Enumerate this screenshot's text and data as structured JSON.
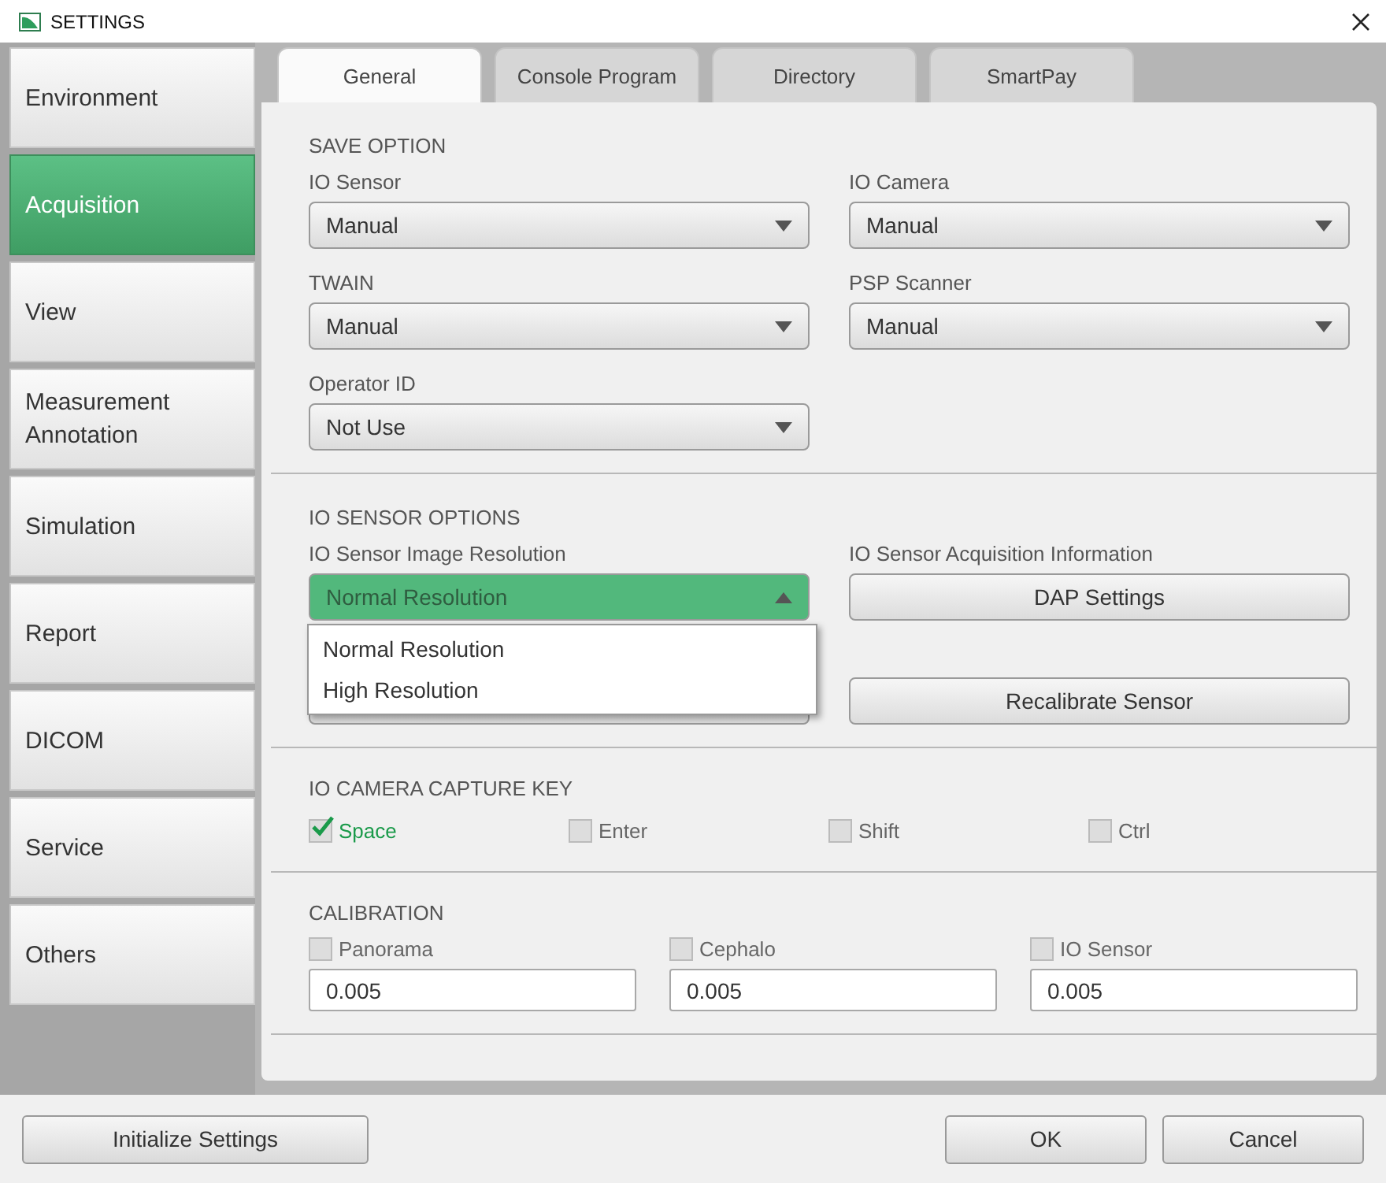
{
  "window": {
    "title": "SETTINGS"
  },
  "sidebar": {
    "items": [
      {
        "label": "Environment",
        "selected": false
      },
      {
        "label": "Acquisition",
        "selected": true
      },
      {
        "label": "View",
        "selected": false
      },
      {
        "label": "Measurement Annotation",
        "selected": false
      },
      {
        "label": "Simulation",
        "selected": false
      },
      {
        "label": "Report",
        "selected": false
      },
      {
        "label": "DICOM",
        "selected": false
      },
      {
        "label": "Service",
        "selected": false
      },
      {
        "label": "Others",
        "selected": false
      }
    ]
  },
  "tabs": [
    {
      "label": "General",
      "selected": true
    },
    {
      "label": "Console Program",
      "selected": false
    },
    {
      "label": "Directory",
      "selected": false
    },
    {
      "label": "SmartPay",
      "selected": false
    }
  ],
  "save_option": {
    "heading": "SAVE OPTION",
    "fields": [
      {
        "label": "IO Sensor",
        "value": "Manual"
      },
      {
        "label": "IO Camera",
        "value": "Manual"
      },
      {
        "label": "TWAIN",
        "value": "Manual"
      },
      {
        "label": "PSP Scanner",
        "value": "Manual"
      },
      {
        "label": "Operator ID",
        "value": "Not Use"
      }
    ]
  },
  "io_sensor_options": {
    "heading": "IO SENSOR OPTIONS",
    "resolution": {
      "label": "IO Sensor Image Resolution",
      "value": "Normal Resolution",
      "expanded": true,
      "options": [
        "Normal Resolution",
        "High Resolution"
      ]
    },
    "acquisition_info": {
      "label": "IO Sensor Acquisition Information",
      "button": "DAP Settings"
    },
    "recalibrate_button": "Recalibrate Sensor"
  },
  "capture_key": {
    "heading": "IO CAMERA CAPTURE KEY",
    "keys": [
      {
        "label": "Space",
        "checked": true
      },
      {
        "label": "Enter",
        "checked": false
      },
      {
        "label": "Shift",
        "checked": false
      },
      {
        "label": "Ctrl",
        "checked": false
      }
    ]
  },
  "calibration": {
    "heading": "CALIBRATION",
    "items": [
      {
        "label": "Panorama",
        "checked": false,
        "value": "0.005"
      },
      {
        "label": "Cephalo",
        "checked": false,
        "value": "0.005"
      },
      {
        "label": "IO Sensor",
        "checked": false,
        "value": "0.005"
      }
    ]
  },
  "footer": {
    "initialize": "Initialize Settings",
    "ok": "OK",
    "cancel": "Cancel"
  }
}
